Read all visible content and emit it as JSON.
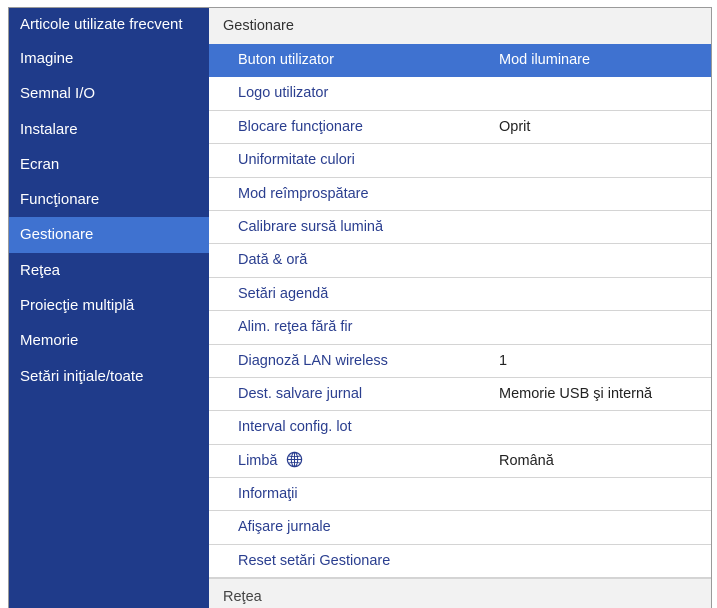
{
  "sidebar": {
    "items": [
      {
        "label": "Articole utilizate frecvent",
        "active": false
      },
      {
        "label": "Imagine",
        "active": false
      },
      {
        "label": "Semnal I/O",
        "active": false
      },
      {
        "label": "Instalare",
        "active": false
      },
      {
        "label": "Ecran",
        "active": false
      },
      {
        "label": "Funcţionare",
        "active": false
      },
      {
        "label": "Gestionare",
        "active": true
      },
      {
        "label": "Reţea",
        "active": false
      },
      {
        "label": "Proiecţie multiplă",
        "active": false
      },
      {
        "label": "Memorie",
        "active": false
      },
      {
        "label": "Setări iniţiale/toate",
        "active": false
      }
    ]
  },
  "panel": {
    "title": "Gestionare",
    "rows": [
      {
        "label": "Buton utilizator",
        "value": "Mod iluminare"
      },
      {
        "label": "Logo utilizator",
        "value": ""
      },
      {
        "label": "Blocare funcţionare",
        "value": "Oprit"
      },
      {
        "label": "Uniformitate culori",
        "value": ""
      },
      {
        "label": "Mod reîmprospătare",
        "value": ""
      },
      {
        "label": "Calibrare sursă lumină",
        "value": ""
      },
      {
        "label": "Dată & oră",
        "value": ""
      },
      {
        "label": "Setări agendă",
        "value": ""
      },
      {
        "label": "Alim. reţea fără fir",
        "value": ""
      },
      {
        "label": "Diagnoză LAN wireless",
        "value": "1"
      },
      {
        "label": "Dest. salvare jurnal",
        "value": "Memorie USB şi internă"
      },
      {
        "label": "Interval config. lot",
        "value": ""
      },
      {
        "label": "Limbă",
        "value": "Română",
        "icon": "globe-icon"
      },
      {
        "label": "Informaţii",
        "value": ""
      },
      {
        "label": "Afişare jurnale",
        "value": ""
      },
      {
        "label": "Reset setări Gestionare",
        "value": ""
      }
    ],
    "next_section": "Reţea"
  },
  "colors": {
    "sidebar_bg": "#1f3b8a",
    "highlight": "#3f72d0",
    "panel_bg": "#f2f2f2",
    "row_text": "#2a3e8f"
  }
}
